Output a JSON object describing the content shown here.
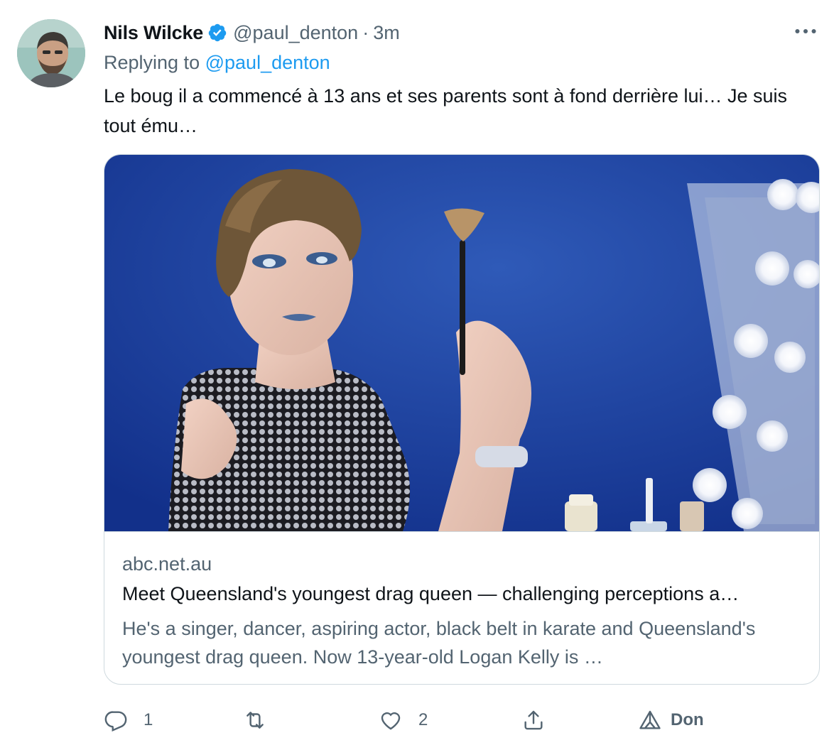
{
  "tweet": {
    "author_name": "Nils Wilcke",
    "handle": "@paul_denton",
    "separator": "·",
    "time": "3m",
    "replying_prefix": "Replying to",
    "replying_to": "@paul_denton",
    "text": "Le boug il a commencé à 13 ans et ses parents sont à fond derrière lui… Je suis tout ému…"
  },
  "card": {
    "domain": "abc.net.au",
    "title": "Meet Queensland's youngest drag queen — challenging perceptions a…",
    "description": "He's a singer, dancer, aspiring actor, black belt in karate and Queensland's youngest drag queen. Now 13-year-old Logan Kelly is …"
  },
  "actions": {
    "reply_count": "1",
    "retweet_count": "",
    "like_count": "2",
    "donate_label": "Don"
  },
  "colors": {
    "text": "#0f1419",
    "secondary": "#536471",
    "link": "#1d9bf0",
    "border": "#cfd9de",
    "verified": "#1d9bf0"
  }
}
